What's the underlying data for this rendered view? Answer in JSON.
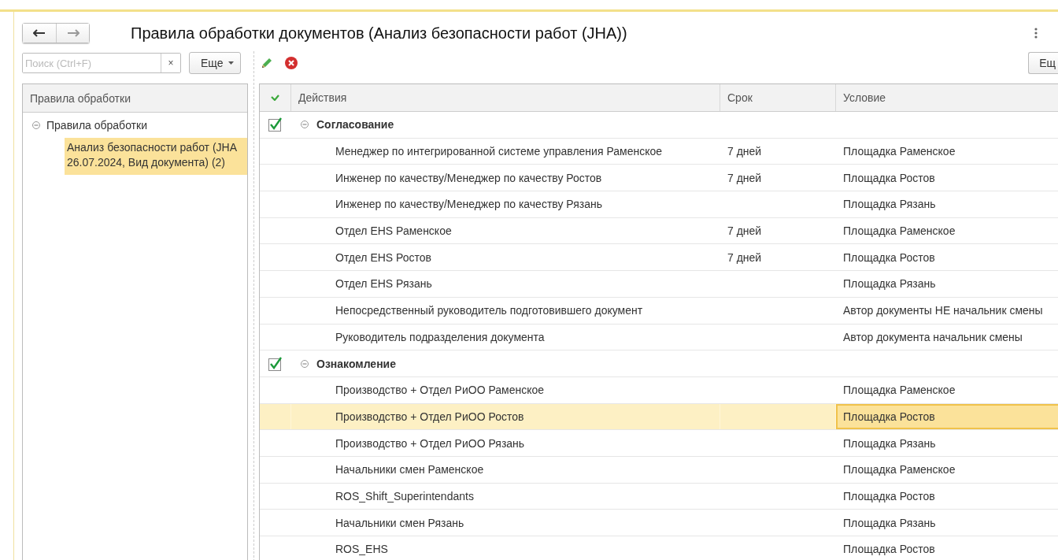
{
  "window": {
    "title": "Правила обработки документов (Анализ безопасности работ (JHA))"
  },
  "search": {
    "placeholder": "Поиск (Ctrl+F)",
    "clear": "×"
  },
  "left_more_button": "Еще",
  "right_more_button": "Ещ",
  "tree": {
    "header": "Правила обработки",
    "items": [
      {
        "label": "Правила обработки",
        "expanded": true,
        "selected": false,
        "children": [
          {
            "lines": [
              "Анализ безопасности работ (JHA",
              "26.07.2024, Вид документа) (2)"
            ],
            "selected": true
          }
        ]
      }
    ]
  },
  "table": {
    "columns": [
      "Действия",
      "Срок",
      "Условие"
    ],
    "groups": [
      {
        "name": "Согласование",
        "checked": true,
        "expanded": true,
        "rows": [
          {
            "action": "Менеджер по интегрированной системе управления Раменское",
            "term": "7 дней",
            "condition": "Площадка Раменское",
            "selected": false
          },
          {
            "action": "Инженер по качеству/Менеджер по качеству Ростов",
            "term": "7 дней",
            "condition": "Площадка Ростов",
            "selected": false
          },
          {
            "action": "Инженер по качеству/Менеджер по качеству Рязань",
            "term": "",
            "condition": "Площадка Рязань",
            "selected": false
          },
          {
            "action": "Отдел EHS Раменское",
            "term": "7 дней",
            "condition": "Площадка Раменское",
            "selected": false
          },
          {
            "action": "Отдел EHS Ростов",
            "term": "7 дней",
            "condition": "Площадка Ростов",
            "selected": false
          },
          {
            "action": "Отдел EHS Рязань",
            "term": "",
            "condition": "Площадка Рязань",
            "selected": false
          },
          {
            "action": "Непосредственный руководитель подготовившего документ",
            "term": "",
            "condition": "Автор документы НЕ начальник смены",
            "selected": false
          },
          {
            "action": "Руководитель подразделения документа",
            "term": "",
            "condition": "Автор документа начальник смены",
            "selected": false
          }
        ]
      },
      {
        "name": "Ознакомление",
        "checked": true,
        "expanded": true,
        "rows": [
          {
            "action": "Производство + Отдел РиОО Раменское",
            "term": "",
            "condition": "Площадка Раменское",
            "selected": false
          },
          {
            "action": "Производство + Отдел РиОО Ростов",
            "term": "",
            "condition": "Площадка Ростов",
            "selected": true
          },
          {
            "action": "Производство + Отдел РиОО Рязань",
            "term": "",
            "condition": "Площадка Рязань",
            "selected": false
          },
          {
            "action": "Начальники смен Раменское",
            "term": "",
            "condition": "Площадка Раменское",
            "selected": false
          },
          {
            "action": "ROS_Shift_Superintendants",
            "term": "",
            "condition": "Площадка Ростов",
            "selected": false
          },
          {
            "action": "Начальники смен Рязань",
            "term": "",
            "condition": "Площадка Рязань",
            "selected": false
          },
          {
            "action": "ROS_EHS",
            "term": "",
            "condition": "Площадка Ростов",
            "selected": false
          }
        ]
      }
    ]
  }
}
